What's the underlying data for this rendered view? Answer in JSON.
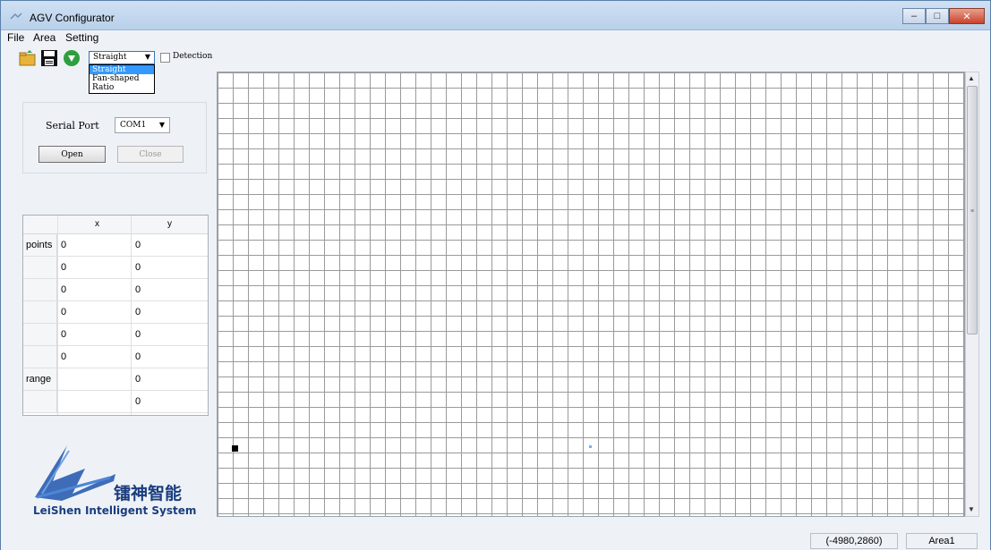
{
  "window": {
    "title": "AGV Configurator"
  },
  "menu": {
    "items": [
      "File",
      "Area",
      "Setting"
    ]
  },
  "toolbar": {
    "icons": [
      "open-folder-icon",
      "save-disk-icon",
      "connect-circle-icon"
    ],
    "mode_selected": "Straight",
    "mode_options": [
      "Straight",
      "Fan-shaped",
      "Ratio"
    ],
    "detection_label": "Detection",
    "detection_checked": false
  },
  "serial": {
    "label": "Serial Port",
    "port_value": "COM1",
    "open_label": "Open",
    "close_label": "Close"
  },
  "table": {
    "columns": [
      "x",
      "y"
    ],
    "rows": [
      {
        "head": "points",
        "x": "0",
        "y": "0"
      },
      {
        "head": "",
        "x": "0",
        "y": "0"
      },
      {
        "head": "",
        "x": "0",
        "y": "0"
      },
      {
        "head": "",
        "x": "0",
        "y": "0"
      },
      {
        "head": "",
        "x": "0",
        "y": "0"
      },
      {
        "head": "",
        "x": "0",
        "y": "0"
      },
      {
        "head": "range",
        "x": "",
        "y": "0"
      },
      {
        "head": "",
        "x": "",
        "y": "0"
      }
    ]
  },
  "logo": {
    "chinese": "镭神智能",
    "english": "LeiShen Intelligent System",
    "color": "#1a3d7e"
  },
  "status": {
    "coordinates": "(-4980,2860)",
    "area": "Area1"
  },
  "colors": {
    "title_gradient_top": "#cfe0f3",
    "selection_blue": "#3399ff",
    "close_button_red": "#c8432c"
  }
}
